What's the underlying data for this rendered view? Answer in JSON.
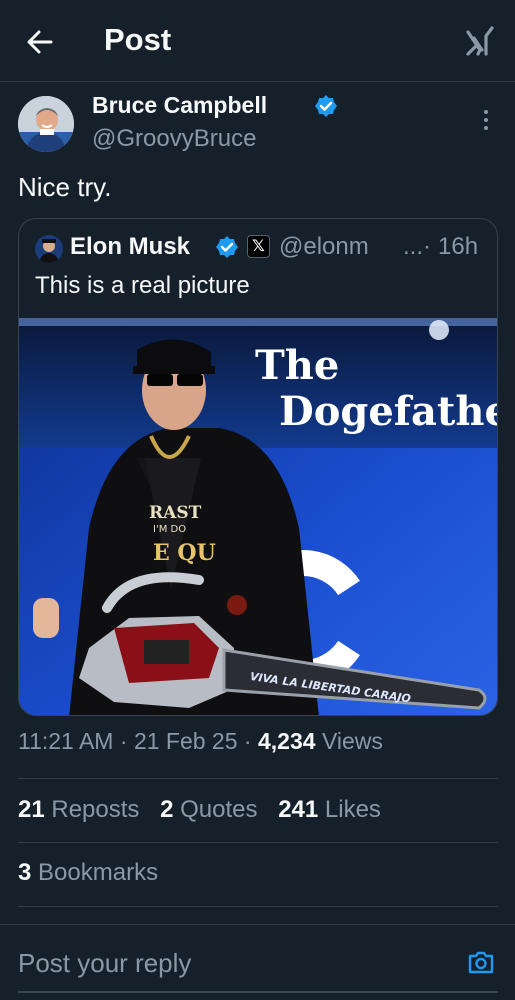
{
  "header": {
    "title": "Post",
    "back_icon": "arrow-left-icon",
    "grok_icon": "grok-icon"
  },
  "post": {
    "author_name": "Bruce Campbell",
    "author_handle": "@GroovyBruce",
    "text": "Nice try.",
    "timestamp": "11:21 AM",
    "date": "21 Feb 25",
    "views_count": "4,234",
    "views_label": "Views"
  },
  "quote": {
    "author_name": "Elon Musk",
    "x_badge": "𝕏",
    "handle": "@elonm",
    "ellipsis": "...",
    "time": "16h",
    "text": "This is a real picture",
    "image_text_line1": "The",
    "image_text_line2": "Dogefather",
    "image_chainsaw_text": "VIVA LA LIBERTAD CARAJO",
    "image_shirt_text_1": "RAST",
    "image_shirt_text_2": "I'M DO",
    "image_shirt_text_3": "E QU"
  },
  "stats": {
    "reposts_count": "21",
    "reposts_label": "Reposts",
    "quotes_count": "2",
    "quotes_label": "Quotes",
    "likes_count": "241",
    "likes_label": "Likes",
    "bookmarks_count": "3",
    "bookmarks_label": "Bookmarks"
  },
  "reply": {
    "placeholder": "Post your reply"
  },
  "colors": {
    "background": "#15202b",
    "accent": "#1d9bf0",
    "muted": "#8b98a5",
    "text": "#f7f9f9"
  }
}
